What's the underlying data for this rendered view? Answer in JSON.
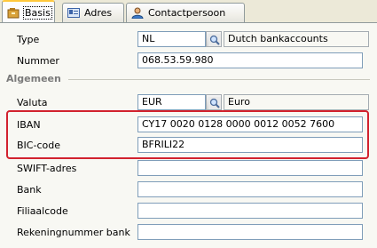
{
  "tabs": [
    {
      "label": "Basis",
      "icon": "basis-tab-icon",
      "active": true
    },
    {
      "label": "Adres",
      "icon": "address-card-icon",
      "active": false
    },
    {
      "label": "Contactpersoon",
      "icon": "contact-person-icon",
      "active": false
    }
  ],
  "fields": {
    "type": {
      "label": "Type",
      "value": "NL",
      "description": "Dutch bankaccounts"
    },
    "nummer": {
      "label": "Nummer",
      "value": "068.53.59.980"
    },
    "section_general": "Algemeen",
    "valuta": {
      "label": "Valuta",
      "value": "EUR",
      "description": "Euro"
    },
    "iban": {
      "label": "IBAN",
      "value": "CY17 0020 0128 0000 0012 0052 7600"
    },
    "bic": {
      "label": "BIC-code",
      "value": "BFRILI22"
    },
    "swift": {
      "label": "SWIFT-adres",
      "value": ""
    },
    "bank": {
      "label": "Bank",
      "value": ""
    },
    "filiaalcode": {
      "label": "Filiaalcode",
      "value": ""
    },
    "rekeningnummer_bank": {
      "label": "Rekeningnummer bank",
      "value": ""
    }
  },
  "colors": {
    "highlight": "#d2222e",
    "field_border": "#7f9db9",
    "tab_active_accent": "#ffc83c"
  }
}
